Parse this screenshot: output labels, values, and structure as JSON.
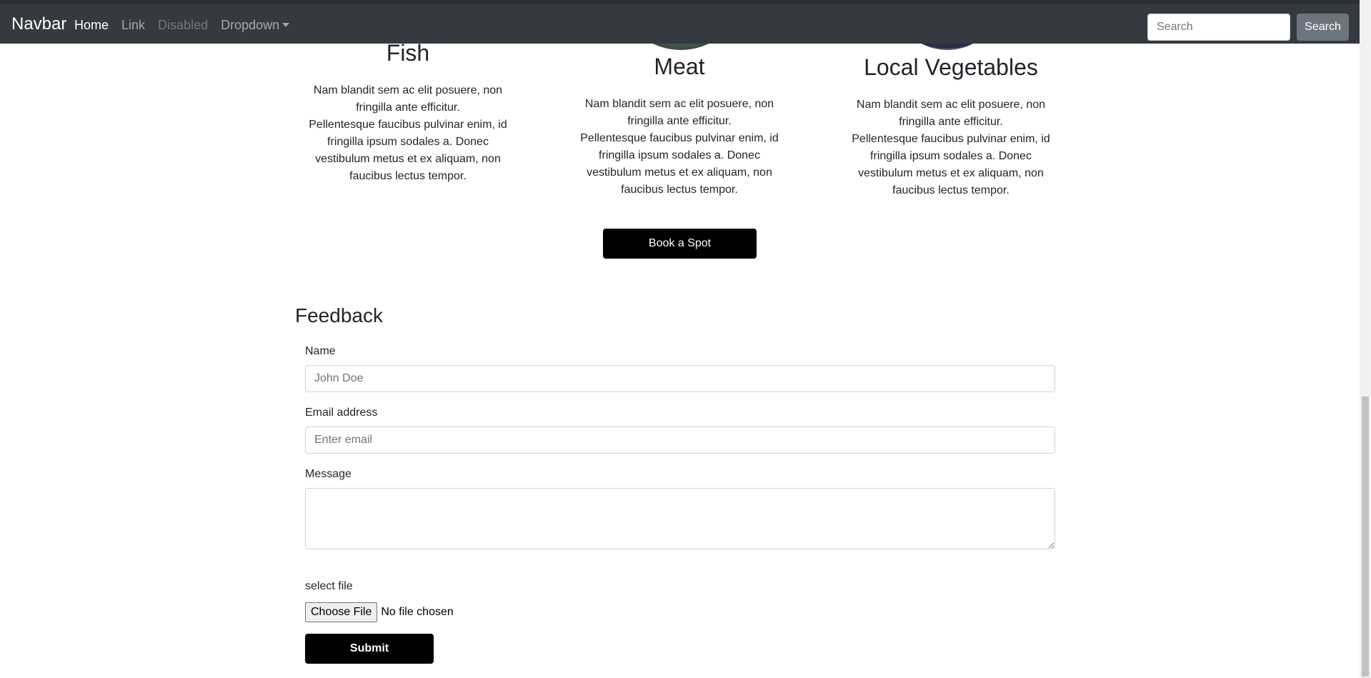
{
  "navbar": {
    "brand": "Navbar",
    "links": [
      {
        "label": "Home"
      },
      {
        "label": "Link"
      },
      {
        "label": "Disabled"
      },
      {
        "label": "Dropdown"
      }
    ],
    "search": {
      "placeholder": "Search",
      "button_label": "Search"
    }
  },
  "products": [
    {
      "title": "Fish",
      "lines": [
        "Nam blandit sem ac elit posuere, non fringilla ante efficitur.",
        "Pellentesque faucibus pulvinar enim, id fringilla ipsum sodales a. Donec vestibulum metus et ex aliquam, non faucibus lectus tempor."
      ]
    },
    {
      "title": "Meat",
      "lines": [
        "Nam blandit sem ac elit posuere, non fringilla ante efficitur.",
        "Pellentesque faucibus pulvinar enim, id fringilla ipsum sodales a. Donec vestibulum metus et ex aliquam, non faucibus lectus tempor."
      ]
    },
    {
      "title": "Local Vegetables",
      "lines": [
        "Nam blandit sem ac elit posuere, non fringilla ante efficitur.",
        "Pellentesque faucibus pulvinar enim, id fringilla ipsum sodales a. Donec vestibulum metus et ex aliquam, non faucibus lectus tempor."
      ]
    }
  ],
  "book_button": "Book a Spot",
  "feedback": {
    "title": "Feedback",
    "name": {
      "label": "Name",
      "placeholder": "John Doe",
      "value": ""
    },
    "email": {
      "label": "Email address",
      "placeholder": "Enter email",
      "value": ""
    },
    "message": {
      "label": "Message",
      "value": ""
    },
    "file": {
      "label": "select file",
      "button_label": "Choose File",
      "status": "No file chosen"
    },
    "submit_label": "Submit"
  },
  "colors": {
    "navbar_bg": "#343a40",
    "primary_button": "#000000",
    "search_button": "#6c757d"
  }
}
